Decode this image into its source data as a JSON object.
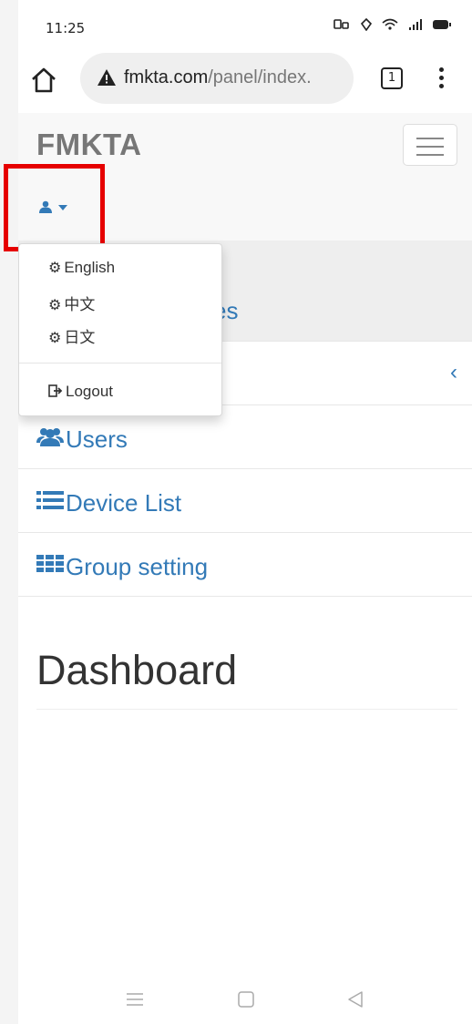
{
  "status": {
    "time": "11:25",
    "icons": [
      "signal-icon",
      "wifi-icon",
      "battery-icon"
    ]
  },
  "browser": {
    "url_host": "fmkta.com",
    "url_path": "/panel/index.",
    "tab_count": "1"
  },
  "navbar": {
    "brand": "FMKTA"
  },
  "dropdown": {
    "items": [
      {
        "label": "English",
        "icon": "gear-icon"
      },
      {
        "label": "中文",
        "icon": "gear-icon"
      },
      {
        "label": "日文",
        "icon": "gear-icon"
      }
    ],
    "logout": "Logout"
  },
  "sidebar": {
    "items": [
      {
        "label": "es",
        "icon": "partially-hidden"
      },
      {
        "label": "",
        "chevron": "‹"
      },
      {
        "label": "Users",
        "icon": "users-icon"
      },
      {
        "label": "Device List",
        "icon": "list-icon"
      },
      {
        "label": "Group setting",
        "icon": "grid-icon"
      }
    ]
  },
  "main": {
    "title": "Dashboard"
  },
  "colors": {
    "link": "#337ab7",
    "highlight": "#e60000"
  }
}
